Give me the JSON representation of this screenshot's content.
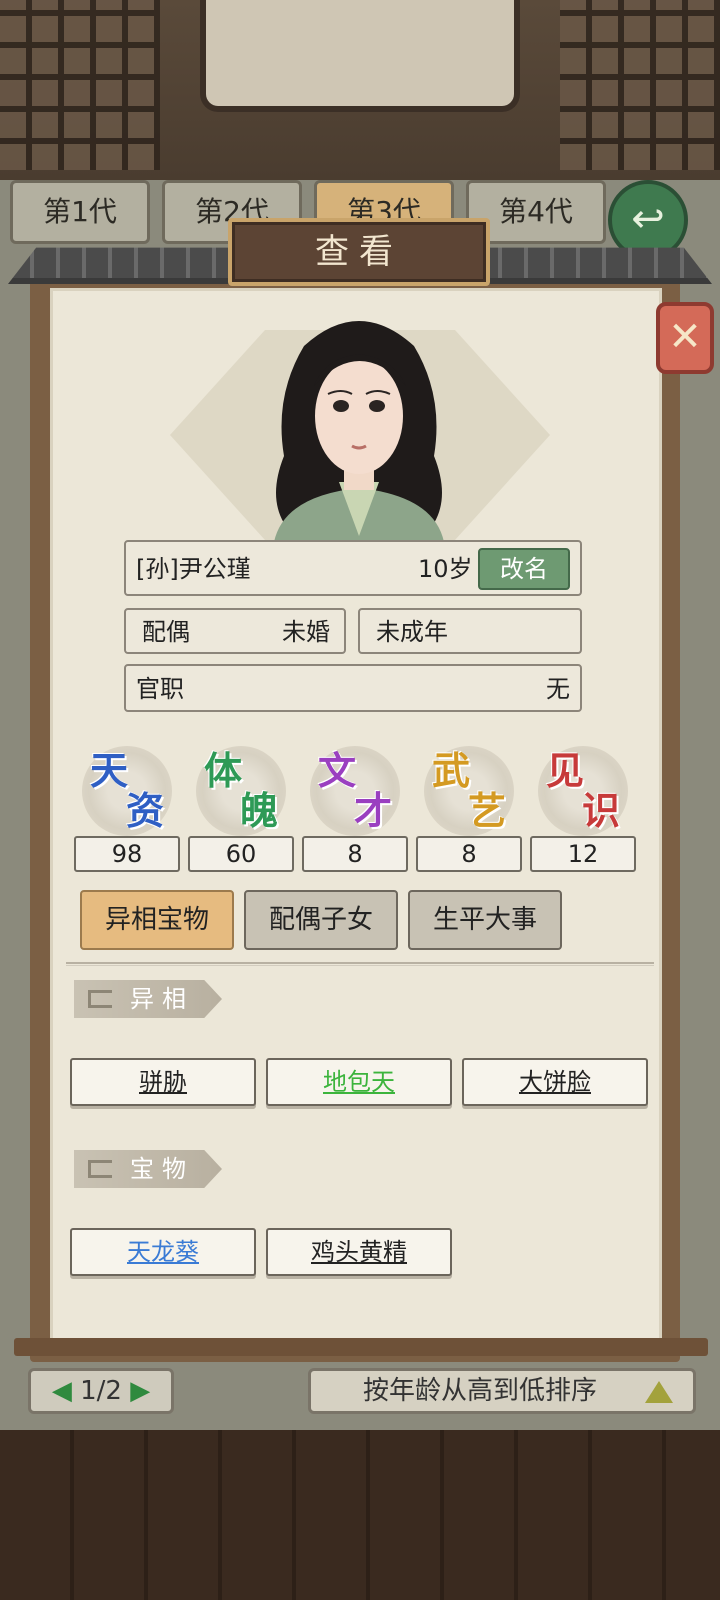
{
  "generation_tabs": [
    "第1代",
    "第2代",
    "第3代",
    "第4代"
  ],
  "active_generation": 2,
  "pager": "1/2",
  "sort_label": "按年龄从高到低排序",
  "dialog": {
    "title": "查看",
    "close_icon": "✕"
  },
  "character": {
    "name": "[孙]尹公瑾",
    "age": "10岁",
    "rename_label": "改名",
    "spouse_label": "配偶",
    "spouse_value": "未婚",
    "adult_status": "未成年",
    "office_label": "官职",
    "office_value": "无"
  },
  "attributes": [
    {
      "c1": "天",
      "c2": "资",
      "value": "98",
      "color": "#2f5fc4"
    },
    {
      "c1": "体",
      "c2": "魄",
      "value": "60",
      "color": "#2e9a56"
    },
    {
      "c1": "文",
      "c2": "才",
      "value": "8",
      "color": "#9a3fc0"
    },
    {
      "c1": "武",
      "c2": "艺",
      "value": "8",
      "color": "#d49a22"
    },
    {
      "c1": "见",
      "c2": "识",
      "value": "12",
      "color": "#c73a3a"
    }
  ],
  "tabs": [
    "异相宝物",
    "配偶子女",
    "生平大事"
  ],
  "active_tab": 0,
  "sections": {
    "traits_title": "异相",
    "traits": [
      {
        "label": "骈胁",
        "color": "#222222"
      },
      {
        "label": "地包天",
        "color": "#3cb43c"
      },
      {
        "label": "大饼脸",
        "color": "#222222"
      }
    ],
    "treasures_title": "宝物",
    "treasures": [
      {
        "label": "天龙葵",
        "color": "#3a7bd5"
      },
      {
        "label": "鸡头黄精",
        "color": "#222222"
      }
    ]
  },
  "colors": {
    "panel": "#ece7d8",
    "frame": "#7b5f44",
    "accent_green": "#6e9a72",
    "active_tab": "#e6bb80"
  }
}
